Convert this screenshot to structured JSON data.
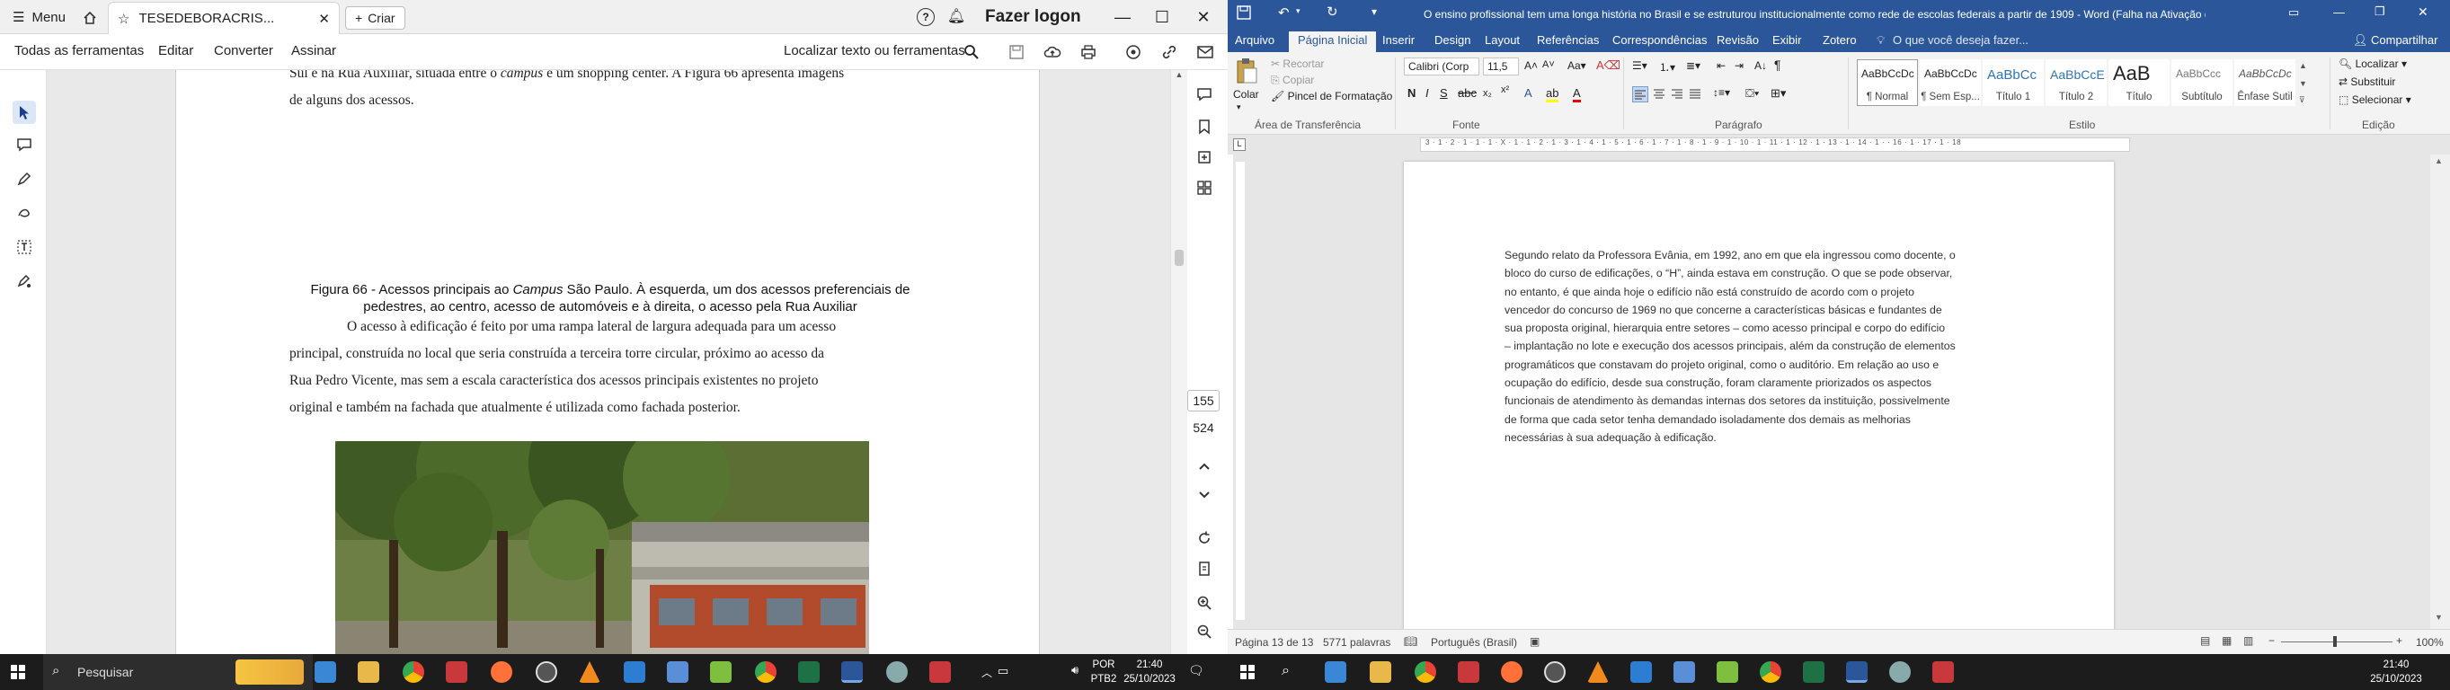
{
  "pdf": {
    "menu_label": "Menu",
    "tab_title": "TESEDEBORACRIS...",
    "new_tab_label": "Criar",
    "sign_in_label": "Fazer logon",
    "toolbar": {
      "all_tools": "Todas as ferramentas",
      "edit": "Editar",
      "convert": "Converter",
      "sign": "Assinar",
      "search_placeholder": "Localizar texto ou ferramentas"
    },
    "page_number": "155",
    "page_total": "524",
    "document": {
      "para_top_1": "Sul e na Rua Auxiliar, situada entre o",
      "para_top_campus": "campus",
      "para_top_2": "e um shopping center. A Figura 66 apresenta imagens",
      "para_top_line2": "de alguns dos acessos.",
      "caption_line1_a": "Figura 66 - Acessos principais ao",
      "caption_campus": "Campus",
      "caption_line1_b": "São Paulo. À esquerda, um dos acessos preferenciais de",
      "caption_line2": "pedestres, ao centro, acesso de automóveis e à direita, o acesso pela Rua Auxiliar",
      "body_line1": "O acesso à edificação é feito por uma rampa lateral de largura adequada para um acesso",
      "body_line2": "principal, construída no local que seria construída a terceira torre circular, próximo ao acesso da",
      "body_line3": "Rua Pedro Vicente, mas sem a escala característica dos acessos principais existentes no projeto",
      "body_line4": "original e também na fachada que atualmente é utilizada como fachada posterior."
    }
  },
  "word": {
    "title": "O ensino profissional tem uma longa história no Brasil e se estruturou institucionalmente como rede de escolas federais a partir de 1909 - Word (Falha na Ativação do Produto)",
    "tabs": [
      "Arquivo",
      "Página Inicial",
      "Inserir",
      "Design",
      "Layout",
      "Referências",
      "Correspondências",
      "Revisão",
      "Exibir",
      "Zotero"
    ],
    "tell_me": "O que você deseja fazer...",
    "share": "Compartilhar",
    "clipboard": {
      "paste": "Colar",
      "cut": "Recortar",
      "copy": "Copiar",
      "format_painter": "Pincel de Formatação",
      "group": "Área de Transferência"
    },
    "font": {
      "name": "Calibri (Corp",
      "size": "11,5",
      "group": "Fonte"
    },
    "paragraph_group": "Parágrafo",
    "styles_group": "Estilo",
    "styles": [
      {
        "sample": "AaBbCcDc",
        "name": "¶ Normal"
      },
      {
        "sample": "AaBbCcDc",
        "name": "¶ Sem Esp..."
      },
      {
        "sample": "AaBbCc",
        "name": "Título 1"
      },
      {
        "sample": "AaBbCcE",
        "name": "Título 2"
      },
      {
        "sample": "AaB",
        "name": "Título"
      },
      {
        "sample": "AaBbCcc",
        "name": "Subtítulo"
      },
      {
        "sample": "AaBbCcDc",
        "name": "Ênfase Sutil"
      }
    ],
    "editing": {
      "find": "Localizar",
      "replace": "Substituir",
      "select": "Selecionar",
      "group": "Edição"
    },
    "ruler_marks": "3 · 1 · 2 · 1 · 1 · 1 · X · 1 · 1 · 2 · 1 · 3 · 1 · 4 · 1 · 5 · 1 · 6 · 1 · 7 · 1 · 8 · 1 · 9 · 1 · 10 · 1 · 11 · 1 · 12 · 1 · 13 · 1 · 14 · 1 ·  · 16 · 1 · 17 · 1 · 18",
    "paragraph": [
      "Segundo relato da Professora Evânia, em 1992,  ano em que ela ingressou como docente, o",
      "bloco do curso de edificações, o “H”, ainda estava em construção.  O que se pode observar,",
      "no entanto, é que ainda hoje o edifício não está construído de acordo com o projeto",
      "vencedor do concurso de 1969  no que concerne a características  básicas e fundantes de",
      "sua proposta original,  hierarquia  entre setores – como acesso principal  e corpo do edifício",
      "– implantação  no lote e execução dos acessos principais,  além da construção  de elementos",
      "programáticos  que constavam  do projeto original,  como o auditório.  Em relação ao uso e",
      "ocupação do edifício, desde sua construção, foram claramente priorizados  os aspectos",
      "funcionais de atendimento  às demandas internas dos setores da instituição,  possivelmente",
      "de forma que cada setor tenha demandado isoladamente dos demais as melhorias",
      "necessárias  à sua adequação à edificação."
    ],
    "status": {
      "page": "Página 13 de 13",
      "words": "5771 palavras",
      "language": "Português (Brasil)",
      "zoom": "100%"
    }
  },
  "taskbar_left": {
    "search": "Pesquisar",
    "lang1": "POR",
    "lang2": "PTB2",
    "time": "21:40",
    "date": "25/10/2023"
  },
  "taskbar_right": {
    "time": "21:40",
    "date": "25/10/2023"
  }
}
